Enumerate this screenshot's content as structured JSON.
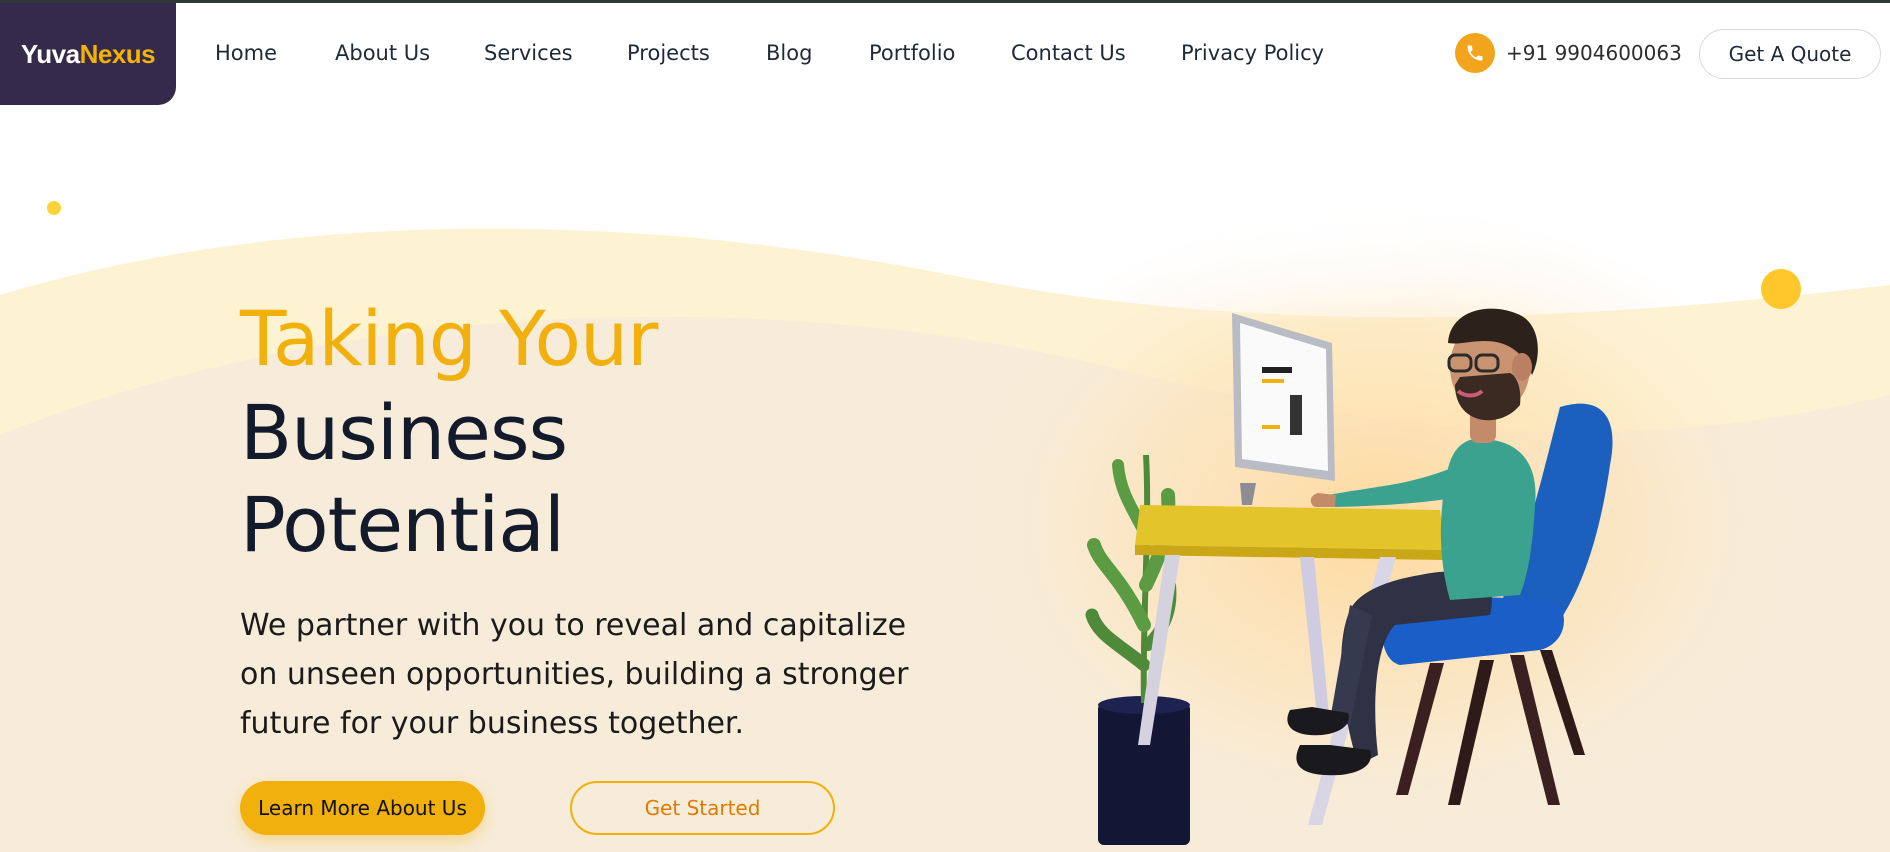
{
  "brand": {
    "name_part1": "Yuva",
    "name_part2": "Nexus"
  },
  "nav": {
    "items": [
      {
        "label": "Home"
      },
      {
        "label": "About Us"
      },
      {
        "label": "Services"
      },
      {
        "label": "Projects"
      },
      {
        "label": "Blog"
      },
      {
        "label": "Portfolio"
      },
      {
        "label": "Contact Us"
      },
      {
        "label": "Privacy Policy"
      }
    ]
  },
  "contact": {
    "phone": "+91 9904600063",
    "icon": "phone-icon"
  },
  "header_cta": {
    "label": "Get A Quote"
  },
  "hero": {
    "title_line1": "Taking Your",
    "title_line2": "Business",
    "title_line3": "Potential",
    "description": "We partner with you to reveal and capitalize on unseen opportunities, building a stronger future for your business together.",
    "primary_button": "Learn More About Us",
    "secondary_button": "Get Started",
    "illustration": "man-working-at-desk-illustration"
  },
  "colors": {
    "accent": "#f2b00c",
    "brand_dark": "#352a4b",
    "heading_dark": "#121a2c",
    "hero_background": "#f7ecd9"
  }
}
